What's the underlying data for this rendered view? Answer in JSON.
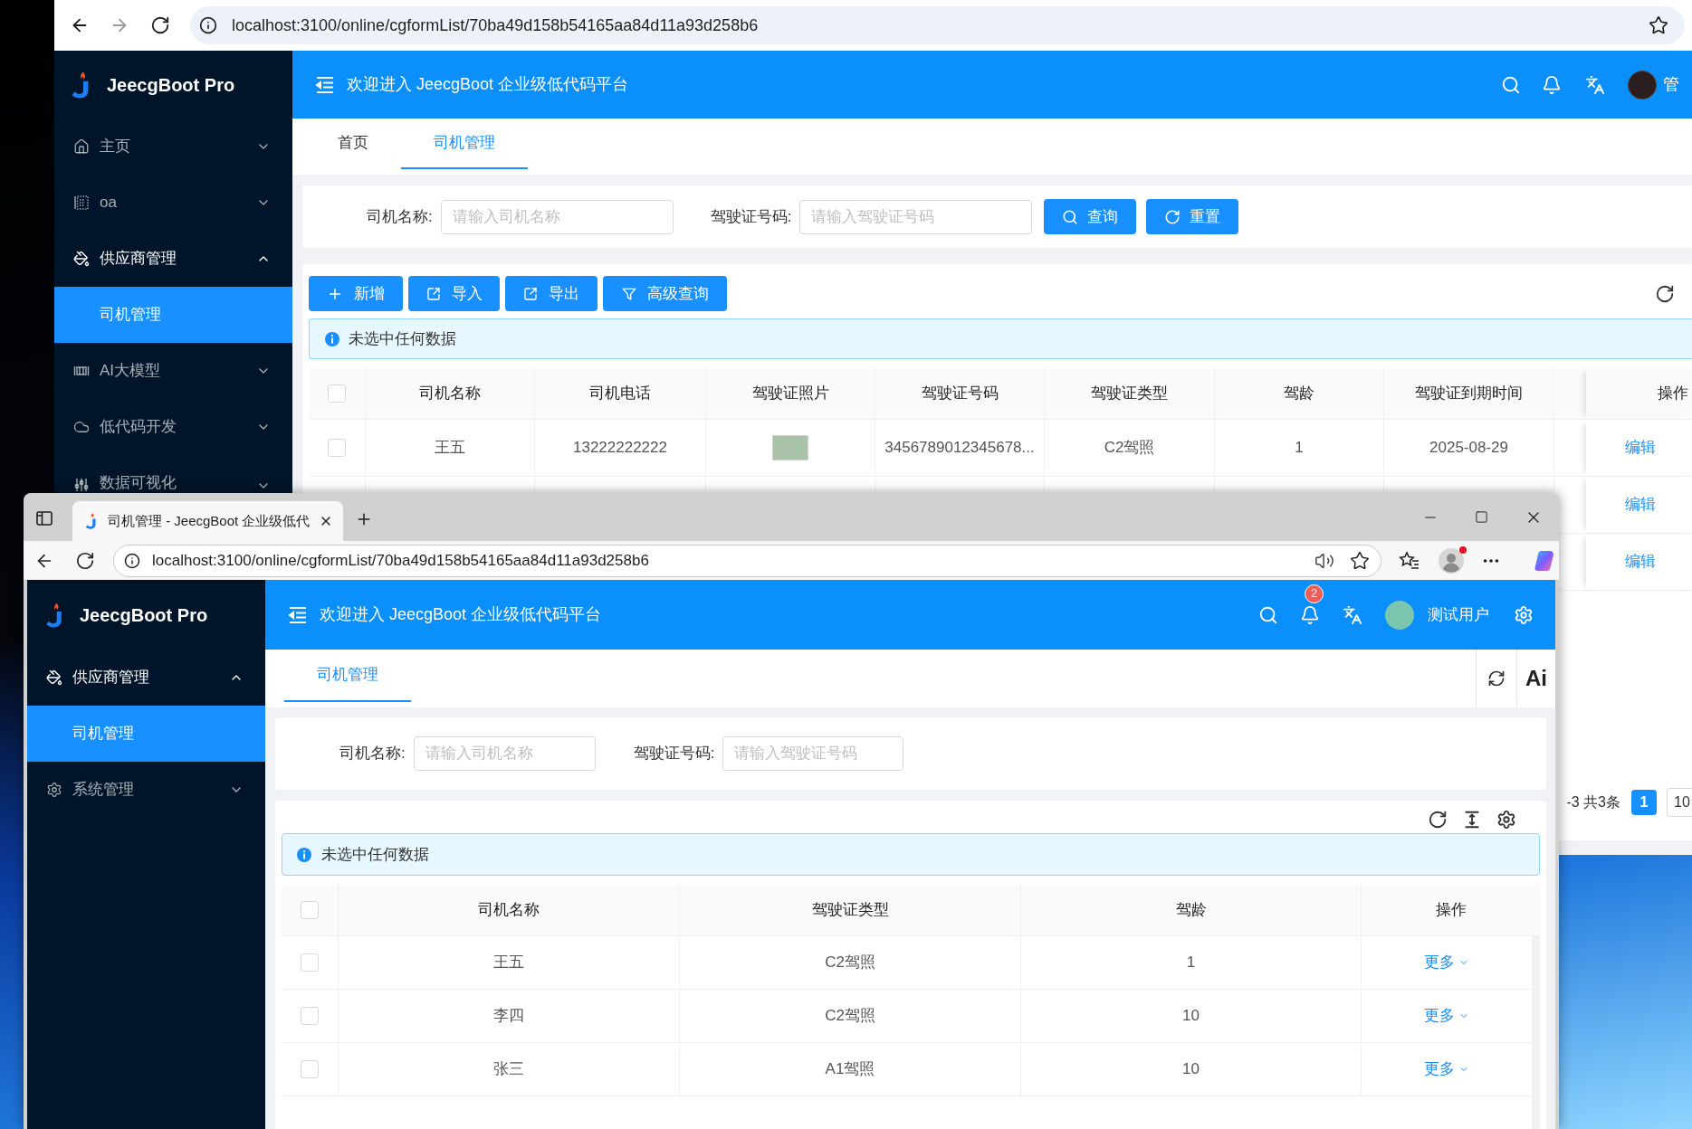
{
  "back_window": {
    "url": "localhost:3100/online/cgformList/70ba49d158b54165aa84d11a93d258b6",
    "logo": "JeecgBoot Pro",
    "header_title": "欢迎进入 JeecgBoot 企业级低代码平台",
    "user_name": "管",
    "sidebar": [
      {
        "label": "主页",
        "expanded": false,
        "selected": false
      },
      {
        "label": "oa",
        "expanded": false,
        "selected": false
      },
      {
        "label": "供应商管理",
        "expanded": true,
        "selected": false,
        "children": [
          {
            "label": "司机管理",
            "selected": true
          }
        ]
      },
      {
        "label": "AI大模型",
        "expanded": false,
        "selected": false
      },
      {
        "label": "低代码开发",
        "expanded": false,
        "selected": false
      },
      {
        "label": "数据可视化",
        "expanded": false,
        "selected": false
      }
    ],
    "tabs": [
      {
        "label": "首页",
        "selected": false
      },
      {
        "label": "司机管理",
        "selected": true
      }
    ],
    "search_form": {
      "fields": [
        {
          "label": "司机名称:",
          "placeholder": "请输入司机名称"
        },
        {
          "label": "驾驶证号码:",
          "placeholder": "请输入驾驶证号码"
        }
      ],
      "buttons": [
        "查询",
        "重置"
      ]
    },
    "toolbar": [
      "新增",
      "导入",
      "导出",
      "高级查询"
    ],
    "alert": "未选中任何数据",
    "table": {
      "select_all": false,
      "columns": [
        "司机名称",
        "司机电话",
        "驾驶证照片",
        "驾驶证号码",
        "驾驶证类型",
        "驾龄",
        "驾驶证到期时间",
        "操作"
      ],
      "rows": [
        {
          "checked": false,
          "name": "王五",
          "phone": "13222222222",
          "photo": true,
          "license_no": "3456789012345678...",
          "license_type": "C2驾照",
          "driving_years": "1",
          "expiry_date": "2025-08-29",
          "actions": [
            "编辑"
          ]
        },
        {
          "actions": [
            "编辑"
          ]
        },
        {
          "actions": [
            "编辑"
          ]
        }
      ]
    },
    "pagination": {
      "summary": "-3 共3条",
      "pages": [
        {
          "label": "1",
          "selected": true
        }
      ],
      "page_size": "10"
    }
  },
  "front_window": {
    "tab_title": "司机管理 - JeecgBoot 企业级低代",
    "url": "localhost:3100/online/cgformList/70ba49d158b54165aa84d11a93d258b6",
    "logo": "JeecgBoot Pro",
    "header_title": "欢迎进入 JeecgBoot 企业级低代码平台",
    "notification_count": "2",
    "user_name": "测试用户",
    "sidebar": [
      {
        "label": "供应商管理",
        "expanded": true,
        "selected": false,
        "children": [
          {
            "label": "司机管理",
            "selected": true
          }
        ]
      },
      {
        "label": "系统管理",
        "expanded": false,
        "selected": false
      }
    ],
    "tabs": [
      {
        "label": "司机管理",
        "selected": true
      }
    ],
    "ai_button": "Ai",
    "search_form": {
      "fields": [
        {
          "label": "司机名称:",
          "placeholder": "请输入司机名称"
        },
        {
          "label": "驾驶证号码:",
          "placeholder": "请输入驾驶证号码"
        }
      ]
    },
    "alert": "未选中任何数据",
    "table": {
      "select_all": false,
      "columns": [
        "司机名称",
        "驾驶证类型",
        "驾龄",
        "操作"
      ],
      "rows": [
        {
          "checked": false,
          "name": "王五",
          "license_type": "C2驾照",
          "driving_years": "1",
          "action": "更多"
        },
        {
          "checked": false,
          "name": "李四",
          "license_type": "C2驾照",
          "driving_years": "10",
          "action": "更多"
        },
        {
          "checked": false,
          "name": "张三",
          "license_type": "A1驾照",
          "driving_years": "10",
          "action": "更多"
        }
      ]
    }
  }
}
